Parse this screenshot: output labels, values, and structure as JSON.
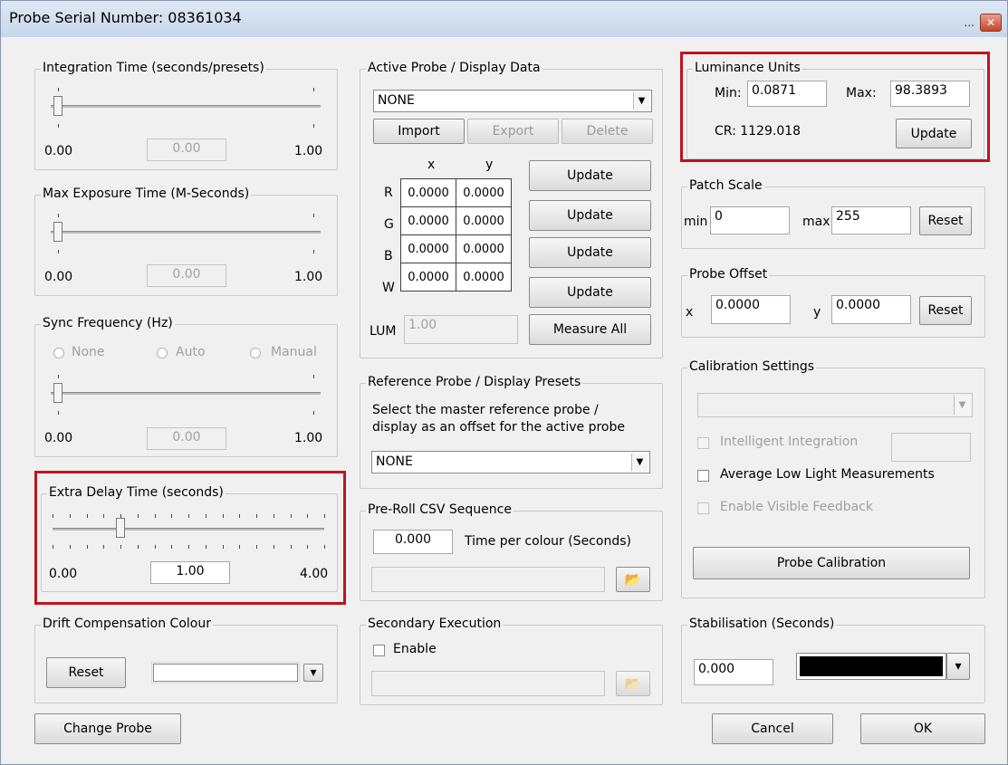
{
  "window": {
    "title": "Probe Serial Number: 08361034",
    "title_extra": "..."
  },
  "integration": {
    "legend": "Integration Time (seconds/presets)",
    "min": "0.00",
    "value": "0.00",
    "max": "1.00"
  },
  "max_exposure": {
    "legend": "Max Exposure Time (M-Seconds)",
    "min": "0.00",
    "value": "0.00",
    "max": "1.00"
  },
  "sync": {
    "legend": "Sync Frequency (Hz)",
    "opt_none": "None",
    "opt_auto": "Auto",
    "opt_manual": "Manual",
    "min": "0.00",
    "value": "0.00",
    "max": "1.00"
  },
  "extra_delay": {
    "legend": "Extra Delay Time (seconds)",
    "min": "0.00",
    "value": "1.00",
    "max": "4.00",
    "level": 0.25
  },
  "drift": {
    "legend": "Drift Compensation Colour",
    "reset": "Reset",
    "arrow": "▾"
  },
  "change_probe": "Change Probe",
  "active_probe": {
    "legend": "Active Probe / Display Data",
    "selected": "NONE",
    "import": "Import",
    "export": "Export",
    "delete": "Delete",
    "col_x": "x",
    "col_y": "y",
    "rows": [
      {
        "label": "R",
        "x": "0.0000",
        "y": "0.0000",
        "button": "Update"
      },
      {
        "label": "G",
        "x": "0.0000",
        "y": "0.0000",
        "button": "Update"
      },
      {
        "label": "B",
        "x": "0.0000",
        "y": "0.0000",
        "button": "Update"
      },
      {
        "label": "W",
        "x": "0.0000",
        "y": "0.0000",
        "button": "Update"
      }
    ],
    "lum_label": "LUM",
    "lum_value": "1.00",
    "measure_all": "Measure All"
  },
  "reference": {
    "legend": "Reference Probe / Display Presets",
    "description_line1": "Select the master reference probe /",
    "description_line2": "display as an offset for the active probe",
    "selected": "NONE"
  },
  "preroll": {
    "legend": "Pre-Roll CSV Sequence",
    "value": "0.000",
    "time_label": "Time per colour (Seconds)",
    "file": ""
  },
  "secondary": {
    "legend": "Secondary Execution",
    "enable": "Enable",
    "file": ""
  },
  "luminance": {
    "legend": "Luminance Units",
    "min_label": "Min:",
    "min_value": "0.0871",
    "max_label": "Max:",
    "max_value": "98.3893",
    "cr": "CR: 1129.018",
    "update": "Update"
  },
  "patch": {
    "legend": "Patch Scale",
    "min_label": "min",
    "min_value": "0",
    "max_label": "max",
    "max_value": "255",
    "reset": "Reset"
  },
  "offset": {
    "legend": "Probe Offset",
    "x_label": "x",
    "x_value": "0.0000",
    "y_label": "y",
    "y_value": "0.0000",
    "reset": "Reset"
  },
  "calibration": {
    "legend": "Calibration Settings",
    "selected": "",
    "intelligent": "Intelligent Integration",
    "average": "Average Low Light Measurements",
    "visible": "Enable Visible Feedback",
    "probe_calibration": "Probe Calibration"
  },
  "stabilisation": {
    "legend": "Stabilisation (Seconds)",
    "value": "0.000",
    "color": "#000000"
  },
  "footer": {
    "cancel": "Cancel",
    "ok": "OK"
  },
  "colors": {
    "highlight": "#c0141c",
    "titlebar": "#c8d7ea"
  }
}
